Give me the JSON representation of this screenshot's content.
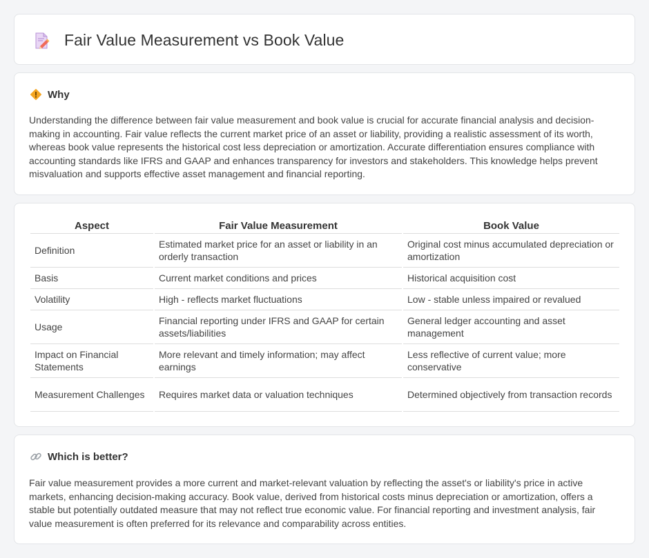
{
  "header": {
    "title": "Fair Value Measurement vs Book Value",
    "icon": "document-pencil-icon"
  },
  "why": {
    "title": "Why",
    "icon": "diamond-warning-icon",
    "text": "Understanding the difference between fair value measurement and book value is crucial for accurate financial analysis and decision-making in accounting. Fair value reflects the current market price of an asset or liability, providing a realistic assessment of its worth, whereas book value represents the historical cost less depreciation or amortization. Accurate differentiation ensures compliance with accounting standards like IFRS and GAAP and enhances transparency for investors and stakeholders. This knowledge helps prevent misvaluation and supports effective asset management and financial reporting."
  },
  "table": {
    "headers": [
      "Aspect",
      "Fair Value Measurement",
      "Book Value"
    ],
    "rows": [
      [
        "Definition",
        "Estimated market price for an asset or liability in an orderly transaction",
        "Original cost minus accumulated depreciation or amortization"
      ],
      [
        "Basis",
        "Current market conditions and prices",
        "Historical acquisition cost"
      ],
      [
        "Volatility",
        "High - reflects market fluctuations",
        "Low - stable unless impaired or revalued"
      ],
      [
        "Usage",
        "Financial reporting under IFRS and GAAP for certain assets/liabilities",
        "General ledger accounting and asset management"
      ],
      [
        "Impact on Financial Statements",
        "More relevant and timely information; may affect earnings",
        "Less reflective of current value; more conservative"
      ],
      [
        "Measurement Challenges",
        "Requires market data or valuation techniques",
        "Determined objectively from transaction records"
      ]
    ]
  },
  "better": {
    "title": "Which is better?",
    "icon": "link-icon",
    "text": "Fair value measurement provides a more current and market-relevant valuation by reflecting the asset's or liability's price in active markets, enhancing decision-making accuracy. Book value, derived from historical costs minus depreciation or amortization, offers a stable but potentially outdated measure that may not reflect true economic value. For financial reporting and investment analysis, fair value measurement is often preferred for its relevance and comparability across entities."
  },
  "colors": {
    "background": "#f4f5f7",
    "card": "#ffffff",
    "border": "#e3e5e8",
    "text": "#333333",
    "icon_orange": "#f5a623"
  }
}
